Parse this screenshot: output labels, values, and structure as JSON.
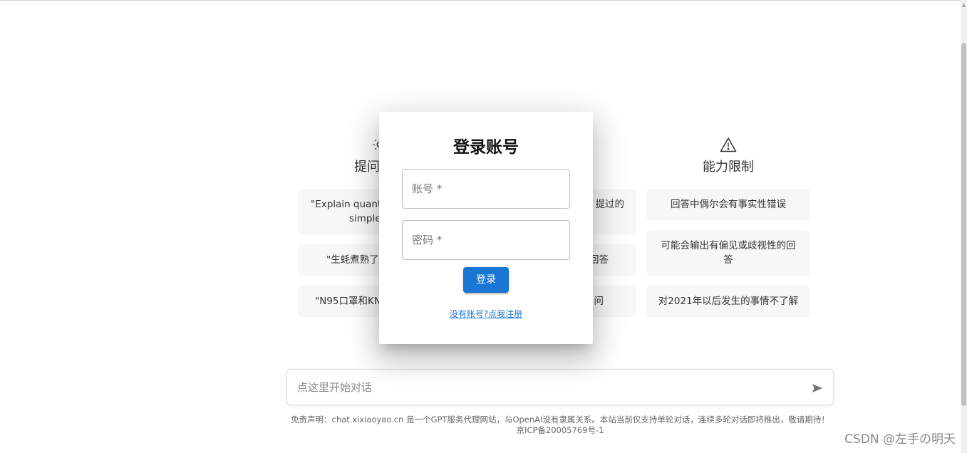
{
  "columns": [
    {
      "title": "提问",
      "icon": "sun-icon",
      "cards": [
        "\"Explain quantu",
        "simple",
        "\"生蚝煮熟了",
        "\"N95口罩和KN"
      ]
    },
    {
      "title": "",
      "icon": "",
      "cards": [
        "提过的",
        "回答",
        "问"
      ]
    },
    {
      "title": "能力限制",
      "icon": "warning-icon",
      "cards": [
        "回答中偶尔会有事实性错误",
        "可能会输出有偏见或歧视性的回答",
        "对2021年以后发生的事情不了解"
      ]
    }
  ],
  "chat": {
    "placeholder": "点这里开始对话",
    "send_icon": "send-icon"
  },
  "disclaimer": {
    "line1": "免责声明：chat.xixiaoyao.cn 是一个GPT服务代理网站，与OpenAI没有隶属关系。本站当前仅支持单轮对话，连续多轮对话即将推出，敬请期待！",
    "line2": "京ICP备20005769号-1"
  },
  "modal": {
    "title": "登录账号",
    "account_placeholder": "账号 *",
    "password_placeholder": "密码 *",
    "login_label": "登录",
    "register_link": "没有账号?点我注册"
  },
  "watermark": "CSDN @左手の明天",
  "colors": {
    "primary": "#1976d2",
    "card_bg": "#f7f7f8"
  }
}
